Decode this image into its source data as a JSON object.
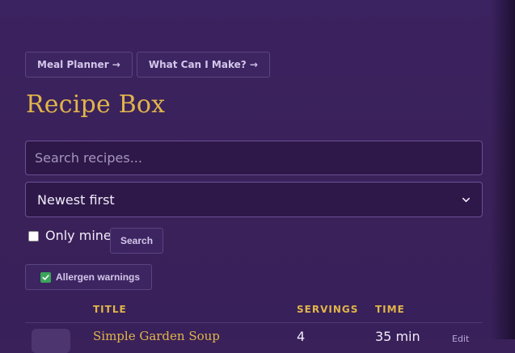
{
  "nav": {
    "meal_planner_label": "Meal Planner →",
    "what_can_i_make_label": "What Can I Make? →"
  },
  "page": {
    "title": "Recipe Box"
  },
  "search": {
    "placeholder": "Search recipes...",
    "value": ""
  },
  "sort": {
    "selected": "Newest first"
  },
  "filters": {
    "only_mine_label": "Only mine",
    "only_mine_checked": false,
    "search_button_label": "Search",
    "allergen_label": "Allergen warnings",
    "allergen_checked": true
  },
  "table": {
    "headers": {
      "title": "TITLE",
      "servings": "SERVINGS",
      "time": "TIME"
    },
    "rows": [
      {
        "title": "Simple Garden Soup",
        "servings": "4",
        "time": "35 min",
        "edit_label": "Edit"
      }
    ]
  },
  "colors": {
    "background": "#3a2159",
    "accent_gold": "#e1b54a",
    "button_bg": "#3d2562",
    "check_green": "#3aa55a"
  },
  "icons": {
    "allergen_check": "check-box-icon",
    "select_chevron": "chevron-down-icon"
  }
}
